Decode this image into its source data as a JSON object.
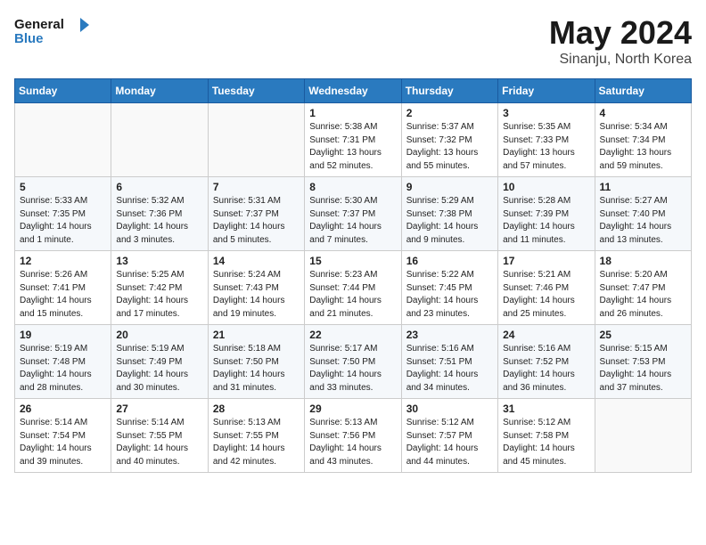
{
  "logo": {
    "line1": "General",
    "line2": "Blue"
  },
  "title": "May 2024",
  "subtitle": "Sinanju, North Korea",
  "weekdays": [
    "Sunday",
    "Monday",
    "Tuesday",
    "Wednesday",
    "Thursday",
    "Friday",
    "Saturday"
  ],
  "weeks": [
    [
      {
        "day": "",
        "sunrise": "",
        "sunset": "",
        "daylight": ""
      },
      {
        "day": "",
        "sunrise": "",
        "sunset": "",
        "daylight": ""
      },
      {
        "day": "",
        "sunrise": "",
        "sunset": "",
        "daylight": ""
      },
      {
        "day": "1",
        "sunrise": "Sunrise: 5:38 AM",
        "sunset": "Sunset: 7:31 PM",
        "daylight": "Daylight: 13 hours and 52 minutes."
      },
      {
        "day": "2",
        "sunrise": "Sunrise: 5:37 AM",
        "sunset": "Sunset: 7:32 PM",
        "daylight": "Daylight: 13 hours and 55 minutes."
      },
      {
        "day": "3",
        "sunrise": "Sunrise: 5:35 AM",
        "sunset": "Sunset: 7:33 PM",
        "daylight": "Daylight: 13 hours and 57 minutes."
      },
      {
        "day": "4",
        "sunrise": "Sunrise: 5:34 AM",
        "sunset": "Sunset: 7:34 PM",
        "daylight": "Daylight: 13 hours and 59 minutes."
      }
    ],
    [
      {
        "day": "5",
        "sunrise": "Sunrise: 5:33 AM",
        "sunset": "Sunset: 7:35 PM",
        "daylight": "Daylight: 14 hours and 1 minute."
      },
      {
        "day": "6",
        "sunrise": "Sunrise: 5:32 AM",
        "sunset": "Sunset: 7:36 PM",
        "daylight": "Daylight: 14 hours and 3 minutes."
      },
      {
        "day": "7",
        "sunrise": "Sunrise: 5:31 AM",
        "sunset": "Sunset: 7:37 PM",
        "daylight": "Daylight: 14 hours and 5 minutes."
      },
      {
        "day": "8",
        "sunrise": "Sunrise: 5:30 AM",
        "sunset": "Sunset: 7:37 PM",
        "daylight": "Daylight: 14 hours and 7 minutes."
      },
      {
        "day": "9",
        "sunrise": "Sunrise: 5:29 AM",
        "sunset": "Sunset: 7:38 PM",
        "daylight": "Daylight: 14 hours and 9 minutes."
      },
      {
        "day": "10",
        "sunrise": "Sunrise: 5:28 AM",
        "sunset": "Sunset: 7:39 PM",
        "daylight": "Daylight: 14 hours and 11 minutes."
      },
      {
        "day": "11",
        "sunrise": "Sunrise: 5:27 AM",
        "sunset": "Sunset: 7:40 PM",
        "daylight": "Daylight: 14 hours and 13 minutes."
      }
    ],
    [
      {
        "day": "12",
        "sunrise": "Sunrise: 5:26 AM",
        "sunset": "Sunset: 7:41 PM",
        "daylight": "Daylight: 14 hours and 15 minutes."
      },
      {
        "day": "13",
        "sunrise": "Sunrise: 5:25 AM",
        "sunset": "Sunset: 7:42 PM",
        "daylight": "Daylight: 14 hours and 17 minutes."
      },
      {
        "day": "14",
        "sunrise": "Sunrise: 5:24 AM",
        "sunset": "Sunset: 7:43 PM",
        "daylight": "Daylight: 14 hours and 19 minutes."
      },
      {
        "day": "15",
        "sunrise": "Sunrise: 5:23 AM",
        "sunset": "Sunset: 7:44 PM",
        "daylight": "Daylight: 14 hours and 21 minutes."
      },
      {
        "day": "16",
        "sunrise": "Sunrise: 5:22 AM",
        "sunset": "Sunset: 7:45 PM",
        "daylight": "Daylight: 14 hours and 23 minutes."
      },
      {
        "day": "17",
        "sunrise": "Sunrise: 5:21 AM",
        "sunset": "Sunset: 7:46 PM",
        "daylight": "Daylight: 14 hours and 25 minutes."
      },
      {
        "day": "18",
        "sunrise": "Sunrise: 5:20 AM",
        "sunset": "Sunset: 7:47 PM",
        "daylight": "Daylight: 14 hours and 26 minutes."
      }
    ],
    [
      {
        "day": "19",
        "sunrise": "Sunrise: 5:19 AM",
        "sunset": "Sunset: 7:48 PM",
        "daylight": "Daylight: 14 hours and 28 minutes."
      },
      {
        "day": "20",
        "sunrise": "Sunrise: 5:19 AM",
        "sunset": "Sunset: 7:49 PM",
        "daylight": "Daylight: 14 hours and 30 minutes."
      },
      {
        "day": "21",
        "sunrise": "Sunrise: 5:18 AM",
        "sunset": "Sunset: 7:50 PM",
        "daylight": "Daylight: 14 hours and 31 minutes."
      },
      {
        "day": "22",
        "sunrise": "Sunrise: 5:17 AM",
        "sunset": "Sunset: 7:50 PM",
        "daylight": "Daylight: 14 hours and 33 minutes."
      },
      {
        "day": "23",
        "sunrise": "Sunrise: 5:16 AM",
        "sunset": "Sunset: 7:51 PM",
        "daylight": "Daylight: 14 hours and 34 minutes."
      },
      {
        "day": "24",
        "sunrise": "Sunrise: 5:16 AM",
        "sunset": "Sunset: 7:52 PM",
        "daylight": "Daylight: 14 hours and 36 minutes."
      },
      {
        "day": "25",
        "sunrise": "Sunrise: 5:15 AM",
        "sunset": "Sunset: 7:53 PM",
        "daylight": "Daylight: 14 hours and 37 minutes."
      }
    ],
    [
      {
        "day": "26",
        "sunrise": "Sunrise: 5:14 AM",
        "sunset": "Sunset: 7:54 PM",
        "daylight": "Daylight: 14 hours and 39 minutes."
      },
      {
        "day": "27",
        "sunrise": "Sunrise: 5:14 AM",
        "sunset": "Sunset: 7:55 PM",
        "daylight": "Daylight: 14 hours and 40 minutes."
      },
      {
        "day": "28",
        "sunrise": "Sunrise: 5:13 AM",
        "sunset": "Sunset: 7:55 PM",
        "daylight": "Daylight: 14 hours and 42 minutes."
      },
      {
        "day": "29",
        "sunrise": "Sunrise: 5:13 AM",
        "sunset": "Sunset: 7:56 PM",
        "daylight": "Daylight: 14 hours and 43 minutes."
      },
      {
        "day": "30",
        "sunrise": "Sunrise: 5:12 AM",
        "sunset": "Sunset: 7:57 PM",
        "daylight": "Daylight: 14 hours and 44 minutes."
      },
      {
        "day": "31",
        "sunrise": "Sunrise: 5:12 AM",
        "sunset": "Sunset: 7:58 PM",
        "daylight": "Daylight: 14 hours and 45 minutes."
      },
      {
        "day": "",
        "sunrise": "",
        "sunset": "",
        "daylight": ""
      }
    ]
  ]
}
